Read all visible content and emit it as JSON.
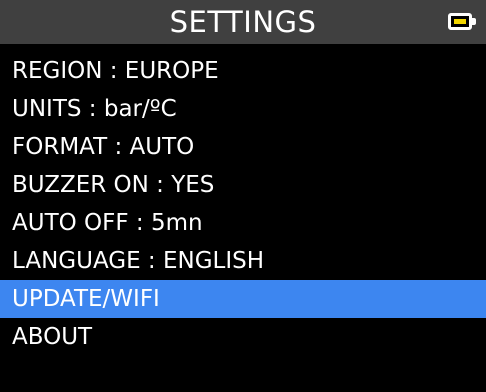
{
  "header": {
    "title": "SETTINGS",
    "battery_icon": "battery-icon",
    "battery_fill_color": "#f2d600"
  },
  "colors": {
    "background": "#000000",
    "title_bar": "#404040",
    "selection": "#3d86f0",
    "text": "#ffffff"
  },
  "menu": {
    "selected_index": 6,
    "items": [
      {
        "label": "REGION : EUROPE"
      },
      {
        "label": "UNITS : bar/ºC"
      },
      {
        "label": "FORMAT : AUTO"
      },
      {
        "label": "BUZZER ON : YES"
      },
      {
        "label": "AUTO OFF : 5mn"
      },
      {
        "label": "LANGUAGE : ENGLISH"
      },
      {
        "label": "UPDATE/WIFI"
      },
      {
        "label": "ABOUT"
      }
    ]
  }
}
